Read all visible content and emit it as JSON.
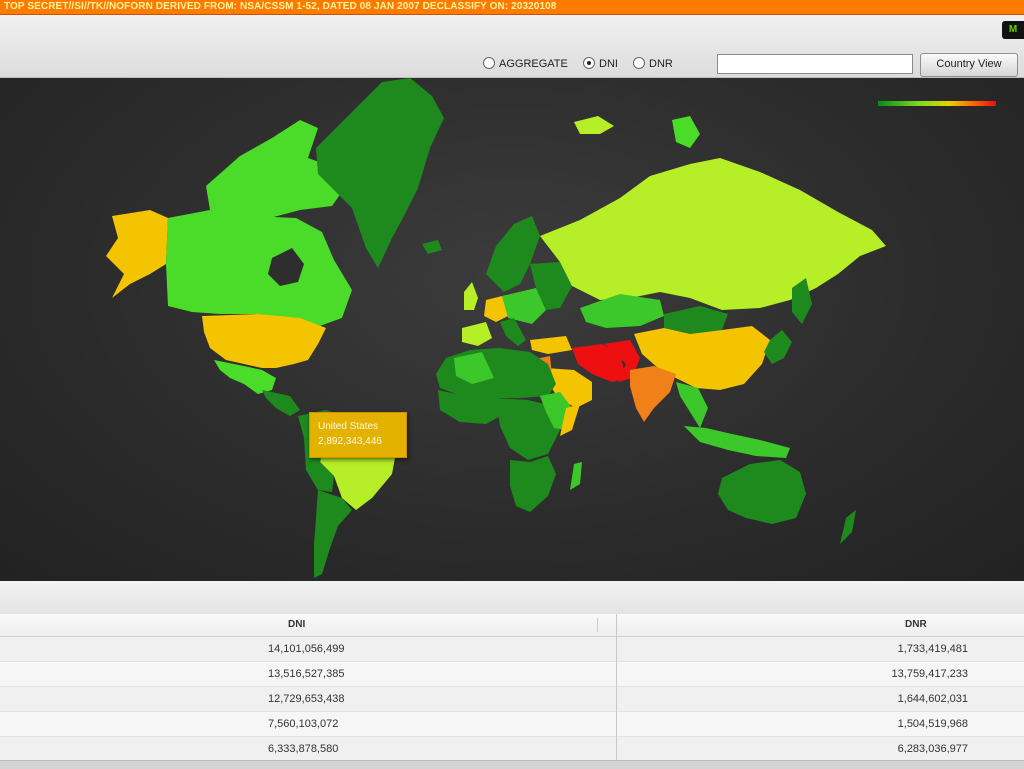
{
  "banner": {
    "text": "TOP SECRET//SI//TK//NOFORN DERIVED FROM: NSA/CSSM 1-52, DATED 08 JAN 2007 DECLASSIFY ON: 20320108"
  },
  "header": {
    "corner_tab": "M"
  },
  "view_options": [
    {
      "label": "AGGREGATE",
      "selected": false
    },
    {
      "label": "DNI",
      "selected": true
    },
    {
      "label": "DNR",
      "selected": false
    }
  ],
  "search": {
    "value": "",
    "placeholder": ""
  },
  "country_view_button": "Country View",
  "map": {
    "legend_gradient": [
      "#0a8a1a",
      "#7ddc1a",
      "#e8d000",
      "#ff6a00",
      "#e01010"
    ],
    "tooltip": {
      "country": "United States",
      "value": "2,892,343,446"
    },
    "colors": {
      "dark_green": "#1e8a1e",
      "green": "#3cc82a",
      "bright_green": "#4bdc2a",
      "yellow_green": "#b6ee28",
      "yellow": "#e8cc00",
      "gold": "#f4c400",
      "orange": "#f28018",
      "red": "#ee1010",
      "ocean": "#2e2e2e"
    }
  },
  "table": {
    "columns": [
      "DNI",
      "DNR"
    ],
    "rows": [
      [
        "14,101,056,499",
        "1,733,419,481"
      ],
      [
        "13,516,527,385",
        "13,759,417,233"
      ],
      [
        "12,729,653,438",
        "1,644,602,031"
      ],
      [
        "7,560,103,072",
        "1,504,519,968"
      ],
      [
        "6,333,878,580",
        "6,283,036,977"
      ]
    ]
  }
}
